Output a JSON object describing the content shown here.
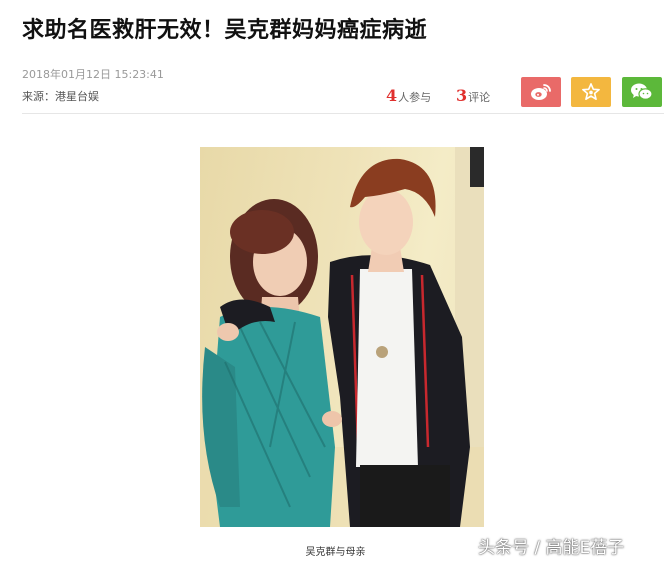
{
  "article": {
    "title": "求助名医救肝无效！吴克群妈妈癌症病逝",
    "date": "2018年01月12日 15:23:41",
    "source": "来源：港星台娱",
    "participants_count": "4",
    "participants_label": "人参与",
    "comments_count": "3",
    "comments_label": "评论"
  },
  "share": {
    "buttons": [
      {
        "name": "weibo",
        "icon": "weibo-icon",
        "color": "#e96a68"
      },
      {
        "name": "favorite",
        "icon": "star-icon",
        "color": "#f3b73f"
      },
      {
        "name": "wechat",
        "icon": "wechat-icon",
        "color": "#5cb83a"
      }
    ]
  },
  "photo": {
    "caption": "吴克群与母亲"
  },
  "watermark": "头条号 / 高能E蓓子"
}
